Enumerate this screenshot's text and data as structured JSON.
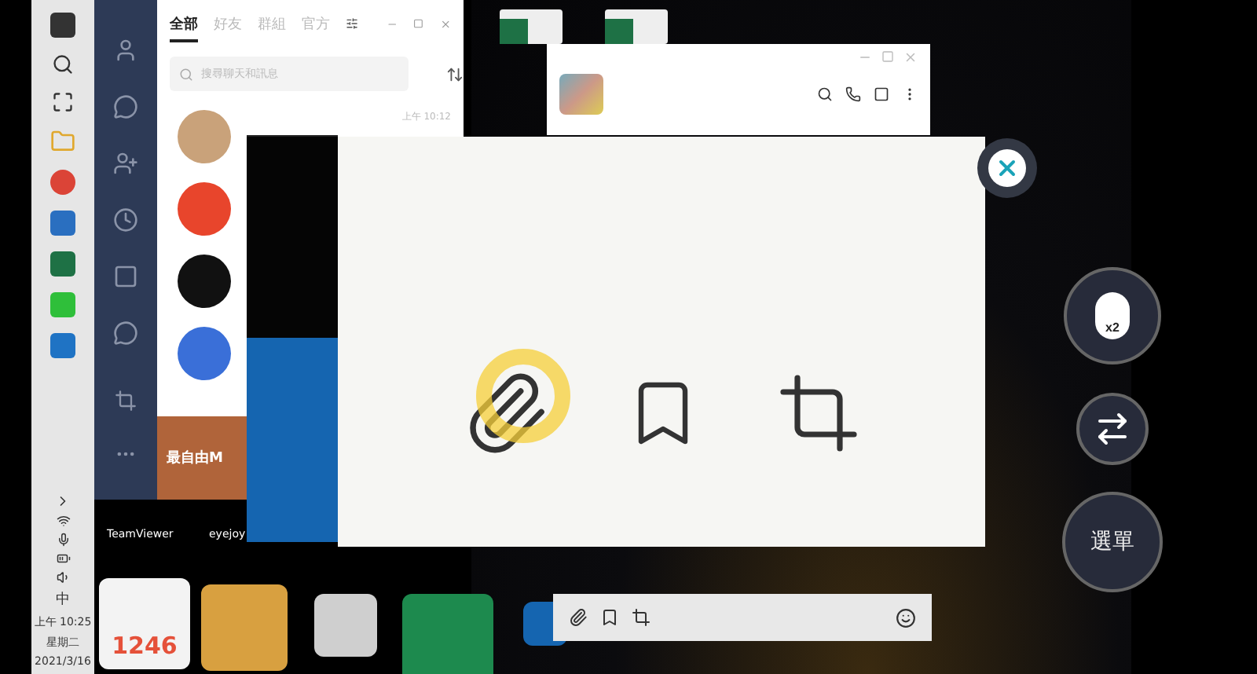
{
  "taskbar": {
    "ime": "中",
    "time": "上午 10:25",
    "weekday": "星期二",
    "date": "2021/3/16"
  },
  "line_window": {
    "tabs": [
      {
        "label": "全部",
        "selected": true
      },
      {
        "label": "好友",
        "selected": false
      },
      {
        "label": "群組",
        "selected": false
      },
      {
        "label": "官方",
        "selected": false
      }
    ],
    "search": {
      "placeholder": "搜尋聊天和訊息"
    },
    "chats": [
      {
        "time": "上午 10:12",
        "color": "#c9a27a"
      },
      {
        "color": "#e8452c"
      },
      {
        "color": "#111111"
      },
      {
        "color": "#3a6fd8"
      }
    ],
    "banner": {
      "title": "最自由M"
    }
  },
  "desktop_icons": [
    {
      "label": "TeamViewer"
    },
    {
      "label": "eyejoy"
    }
  ],
  "app_badge": "1246",
  "controls": {
    "double_click": "x2",
    "menu": "選單"
  }
}
